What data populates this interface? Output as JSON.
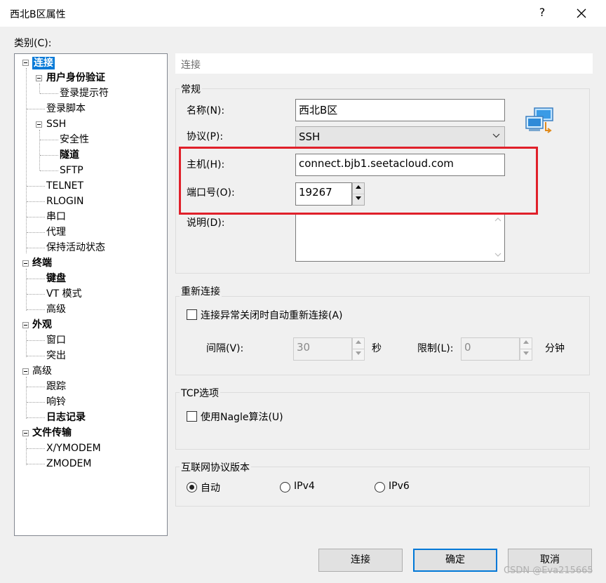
{
  "window": {
    "title": "西北B区属性",
    "help": "?",
    "close_icon": "close-icon"
  },
  "category_label": "类别(C):",
  "tree": {
    "items": [
      {
        "label": "连接",
        "bold": true,
        "selected": true,
        "expanded": true
      },
      {
        "label": "用户身份验证",
        "bold": true,
        "expanded": true
      },
      {
        "label": "登录提示符"
      },
      {
        "label": "登录脚本"
      },
      {
        "label": "SSH",
        "expanded": true
      },
      {
        "label": "安全性"
      },
      {
        "label": "隧道",
        "bold": true
      },
      {
        "label": "SFTP"
      },
      {
        "label": "TELNET"
      },
      {
        "label": "RLOGIN"
      },
      {
        "label": "串口"
      },
      {
        "label": "代理"
      },
      {
        "label": "保持活动状态"
      },
      {
        "label": "终端",
        "bold": true,
        "expanded": true
      },
      {
        "label": "键盘",
        "bold": true
      },
      {
        "label": "VT 模式"
      },
      {
        "label": "高级"
      },
      {
        "label": "外观",
        "bold": true,
        "expanded": true
      },
      {
        "label": "窗口"
      },
      {
        "label": "突出"
      },
      {
        "label": "高级",
        "expanded": true
      },
      {
        "label": "跟踪"
      },
      {
        "label": "响铃"
      },
      {
        "label": "日志记录",
        "bold": true
      },
      {
        "label": "文件传输",
        "bold": true,
        "expanded": true
      },
      {
        "label": "X/YMODEM"
      },
      {
        "label": "ZMODEM"
      }
    ]
  },
  "section_header": "连接",
  "general": {
    "title": "常规",
    "name_label": "名称(N):",
    "name_value": "西北B区",
    "protocol_label": "协议(P):",
    "protocol_value": "SSH",
    "host_label": "主机(H):",
    "host_value": "connect.bjb1.seetacloud.com",
    "port_label": "端口号(O):",
    "port_value": "19267",
    "desc_label": "说明(D):",
    "desc_value": ""
  },
  "reconnect": {
    "title": "重新连接",
    "auto_label": "连接异常关闭时自动重新连接(A)",
    "auto_checked": false,
    "interval_label": "间隔(V):",
    "interval_value": "30",
    "interval_unit": "秒",
    "limit_label": "限制(L):",
    "limit_value": "0",
    "limit_unit": "分钟"
  },
  "tcp": {
    "title": "TCP选项",
    "nagle_label": "使用Nagle算法(U)",
    "nagle_checked": false
  },
  "ip_version": {
    "title": "互联网协议版本",
    "options": [
      "自动",
      "IPv4",
      "IPv6"
    ],
    "selected": "自动"
  },
  "buttons": {
    "connect": "连接",
    "ok": "确定",
    "cancel": "取消"
  },
  "watermark": "CSDN @Eva215665"
}
